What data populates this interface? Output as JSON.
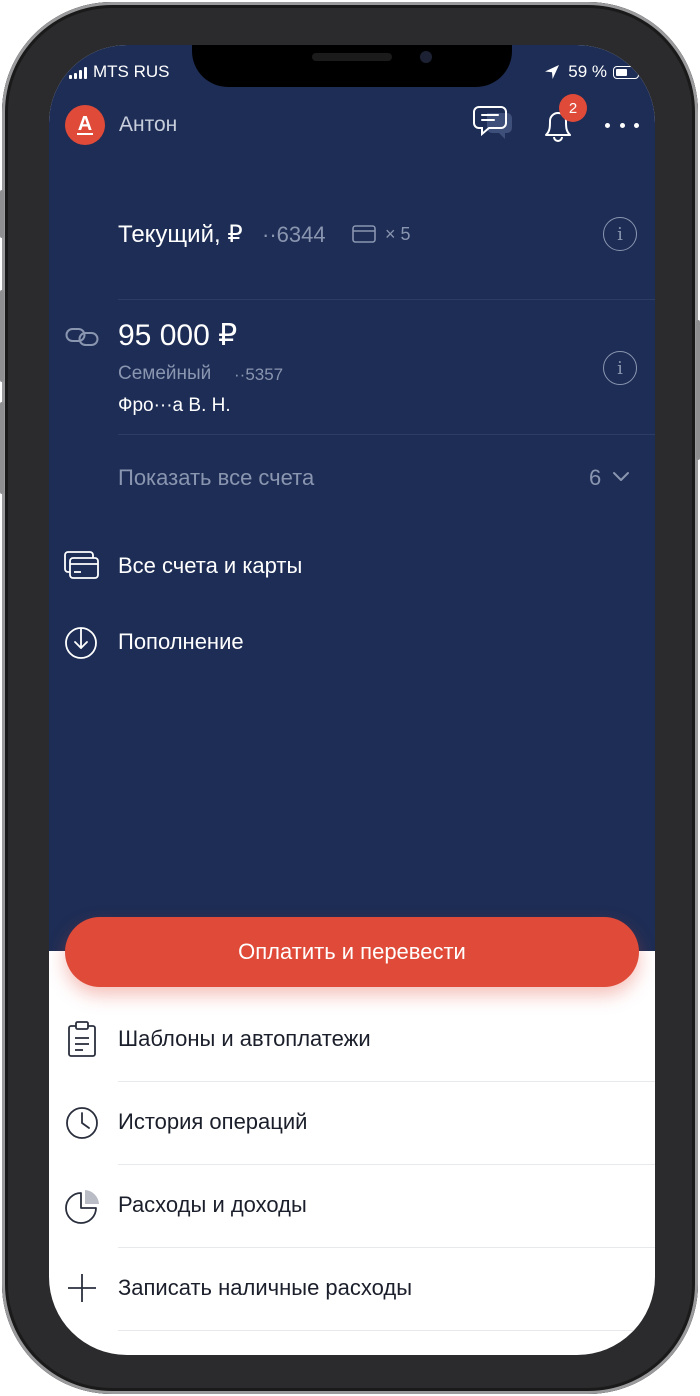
{
  "status_bar": {
    "carrier": "MTS RUS",
    "battery": "59 %",
    "battery_level": 0.59
  },
  "header": {
    "avatar_letter": "А",
    "username": "Антон",
    "notifications_badge": "2"
  },
  "accounts": [
    {
      "title": "Текущий, ₽",
      "number": "··6344",
      "cards": "× 5"
    },
    {
      "amount": "95 000 ₽",
      "name": "Семейный",
      "number": "··5357",
      "owner": "Фро···а В. Н."
    }
  ],
  "show_all": {
    "label": "Показать все счета",
    "count": "6"
  },
  "top_menu": [
    {
      "label": "Все счета и карты",
      "icon": "cards-icon"
    },
    {
      "label": "Пополнение",
      "icon": "download-circle-icon"
    }
  ],
  "pay_button": "Оплатить и перевести",
  "bottom_menu": [
    {
      "label": "Шаблоны и автоплатежи",
      "icon": "clipboard-icon"
    },
    {
      "label": "История операций",
      "icon": "clock-icon"
    },
    {
      "label": "Расходы и доходы",
      "icon": "pie-chart-icon"
    },
    {
      "label": "Записать наличные расходы",
      "icon": "plus-icon"
    }
  ],
  "colors": {
    "navy": "#1d2d55",
    "accent": "#e04a38",
    "muted": "#8a95b0"
  }
}
